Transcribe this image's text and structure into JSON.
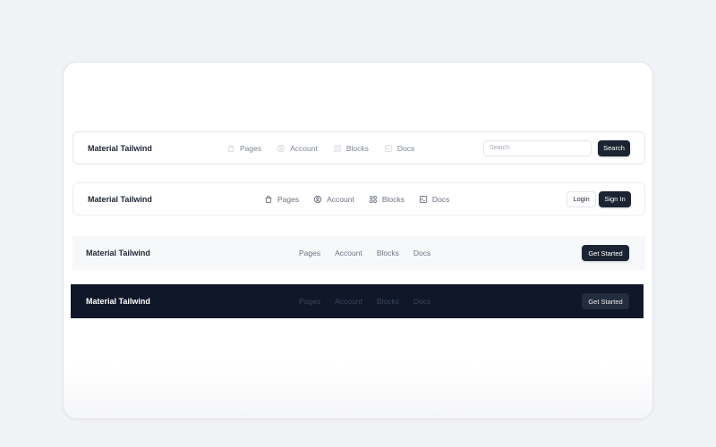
{
  "navbars": [
    {
      "brand": "Material Tailwind",
      "links": [
        {
          "label": "Pages",
          "icon": "shopping-bag-icon"
        },
        {
          "label": "Account",
          "icon": "user-circle-icon"
        },
        {
          "label": "Blocks",
          "icon": "squares-icon"
        },
        {
          "label": "Docs",
          "icon": "terminal-icon"
        }
      ],
      "search_placeholder": "Search",
      "search_button": "Search"
    },
    {
      "brand": "Material Tailwind",
      "links": [
        {
          "label": "Pages",
          "icon": "shopping-bag-icon"
        },
        {
          "label": "Account",
          "icon": "user-circle-icon"
        },
        {
          "label": "Blocks",
          "icon": "squares-icon"
        },
        {
          "label": "Docs",
          "icon": "terminal-icon"
        }
      ],
      "login_button": "Login",
      "signin_button": "Sign In"
    },
    {
      "brand": "Material Tailwind",
      "links": [
        {
          "label": "Pages"
        },
        {
          "label": "Account"
        },
        {
          "label": "Blocks"
        },
        {
          "label": "Docs"
        }
      ],
      "cta_button": "Get Started"
    },
    {
      "brand": "Material Tailwind",
      "links": [
        {
          "label": "Pages"
        },
        {
          "label": "Account"
        },
        {
          "label": "Blocks"
        },
        {
          "label": "Docs"
        }
      ],
      "cta_button": "Get Started"
    }
  ],
  "colors": {
    "page_bg": "#f1f2f5",
    "dark_button": "#1c2433",
    "dark_navbar": "#0f1729",
    "muted_text": "#6b7380"
  }
}
